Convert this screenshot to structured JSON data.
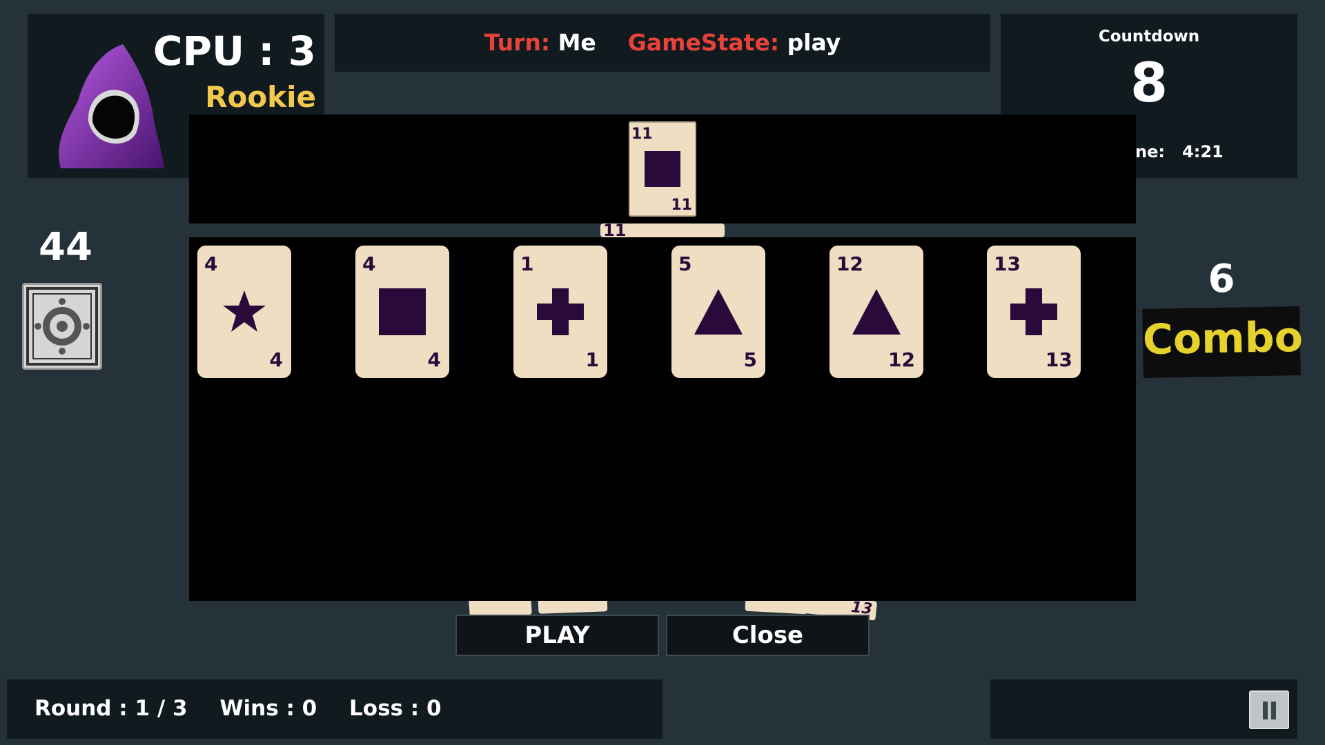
{
  "cpu": {
    "score_label": "CPU : 3",
    "level": "Rookie"
  },
  "status": {
    "turn_label": "Turn:",
    "turn_value": "Me",
    "state_label": "GameState:",
    "state_value": "play"
  },
  "countdown": {
    "label": "Countdown",
    "value": "8",
    "time_label": "ne:",
    "time_value": "4:21"
  },
  "deck": {
    "count": "44"
  },
  "combo": {
    "count": "6",
    "label": "Combo"
  },
  "top_card": {
    "value": "11",
    "suit": "square"
  },
  "hand": [
    {
      "value": "4",
      "suit": "star"
    },
    {
      "value": "4",
      "suit": "square"
    },
    {
      "value": "1",
      "suit": "cross"
    },
    {
      "value": "5",
      "suit": "triangle"
    },
    {
      "value": "12",
      "suit": "triangle"
    },
    {
      "value": "13",
      "suit": "cross"
    }
  ],
  "buttons": {
    "play": "PLAY",
    "close": "Close"
  },
  "bottom": {
    "round": "Round : 1 / 3",
    "wins": "Wins : 0",
    "loss": "Loss : 0"
  },
  "peek": {
    "card_value": "11",
    "card_value_2": "13"
  },
  "colors": {
    "background": "#25323a",
    "panel": "#111a1f",
    "card": "#f0dec3",
    "suit": "#2a0a3a",
    "accent_red": "#e8423a",
    "rank_gold": "#f2c94c",
    "combo_yellow": "#e6d22c"
  },
  "icons": {
    "pause": "pause-icon",
    "avatar": "hooded-figure-avatar",
    "deck": "card-back-ornament-icon"
  }
}
